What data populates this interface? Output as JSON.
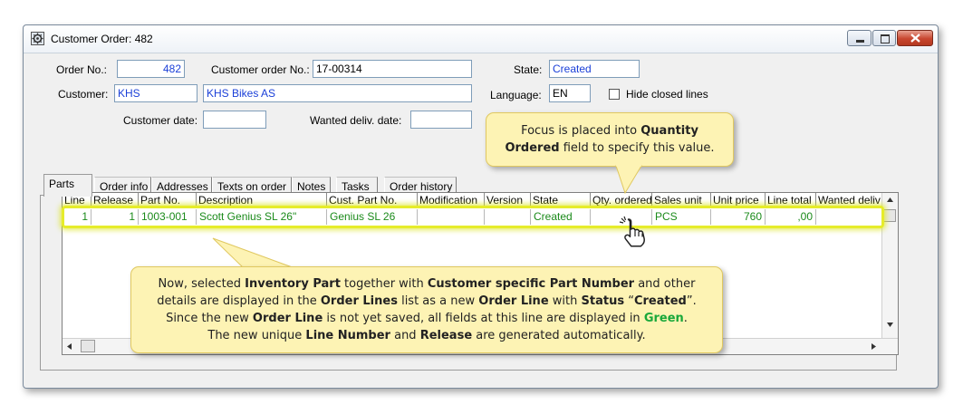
{
  "window": {
    "title": "Customer Order: 482"
  },
  "form": {
    "order_no_label": "Order No.:",
    "order_no_value": "482",
    "customer_order_no_label": "Customer order No.:",
    "customer_order_no_value": "17-00314",
    "state_label": "State:",
    "state_value": "Created",
    "customer_label": "Customer:",
    "customer_code": "KHS",
    "customer_name": "KHS Bikes AS",
    "language_label": "Language:",
    "language_value": "EN",
    "hide_closed_label": "Hide closed lines",
    "customer_date_label": "Customer date:",
    "customer_date_value": "",
    "wanted_deliv_label": "Wanted deliv. date:",
    "wanted_deliv_value": ""
  },
  "tabs": [
    "Parts",
    "Order info",
    "Addresses",
    "Texts on order",
    "Notes",
    "Tasks",
    "Order history"
  ],
  "grid": {
    "columns": [
      "Line",
      "Release",
      "Part No.",
      "Description",
      "Cust. Part No.",
      "Modification",
      "Version",
      "State",
      "Qty. ordered",
      "Sales unit",
      "Unit price",
      "Line total",
      "Wanted deliv"
    ],
    "row": {
      "line": "1",
      "release": "1",
      "part_no": "1003-001",
      "description": "Scott Genius SL 26\"",
      "cust_part_no": "Genius SL 26",
      "modification": "",
      "version": "",
      "state": "Created",
      "qty_ordered": "",
      "sales_unit": "PCS",
      "unit_price": "760",
      "line_total": ",00",
      "wanted_deliv": ""
    }
  },
  "callout_top": {
    "t1": "Focus is placed into ",
    "b1": "Quantity",
    "b2": "Ordered",
    "t2": " field to specify this value."
  },
  "callout_bottom": {
    "l1_a": "Now, selected ",
    "l1_b": "Inventory Part",
    "l1_c": " together with ",
    "l1_d": "Customer specific Part Number",
    "l1_e": " and other",
    "l2_a": "details are displayed in the ",
    "l2_b": "Order Lines",
    "l2_c": " list as a new ",
    "l2_d": "Order Line",
    "l2_e": " with ",
    "l2_f": "Status",
    "l2_g": " “",
    "l2_h": "Created",
    "l2_i": "”.",
    "l3_a": "Since the new ",
    "l3_b": "Order Line",
    "l3_c": " is not yet saved, all fields at this line are displayed in ",
    "l3_d": "Green",
    "l3_e": ".",
    "l4_a": "The new unique ",
    "l4_b": "Line Number",
    "l4_c": " and ",
    "l4_d": "Release",
    "l4_e": " are generated automatically."
  },
  "colors": {
    "line_text": "#1a8a1a",
    "highlight": "#e6ec2a",
    "callout_bg": "#fdf3b4",
    "field_text": "#1a3fd8"
  }
}
